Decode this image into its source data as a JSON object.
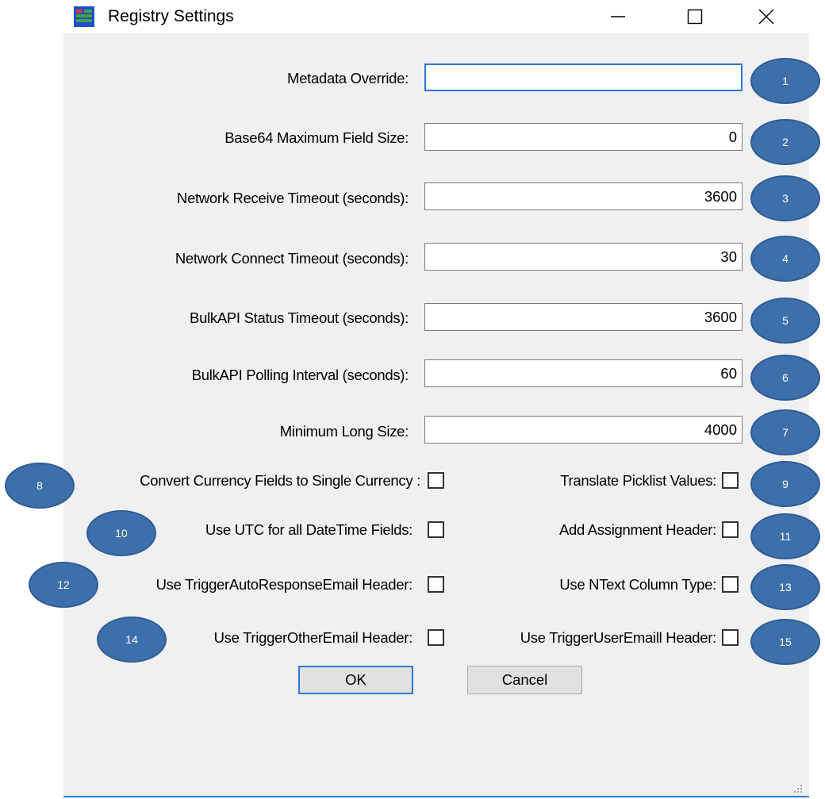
{
  "window": {
    "title": "Registry Settings"
  },
  "fields": [
    {
      "label": "Metadata Override:",
      "value": ""
    },
    {
      "label": "Base64 Maximum Field Size:",
      "value": "0"
    },
    {
      "label": "Network Receive Timeout (seconds):",
      "value": "3600"
    },
    {
      "label": "Network Connect Timeout (seconds):",
      "value": "30"
    },
    {
      "label": "BulkAPI Status Timeout (seconds):",
      "value": "3600"
    },
    {
      "label": "BulkAPI Polling Interval (seconds):",
      "value": "60"
    },
    {
      "label": "Minimum Long Size:",
      "value": "4000"
    }
  ],
  "checkboxes": {
    "left": [
      {
        "label": "Convert Currency Fields to Single Currency :",
        "checked": false
      },
      {
        "label": "Use UTC for all DateTime Fields:",
        "checked": false
      },
      {
        "label": "Use TriggerAutoResponseEmail Header:",
        "checked": false
      },
      {
        "label": "Use TriggerOtherEmail Header:",
        "checked": false
      }
    ],
    "right": [
      {
        "label": "Translate Picklist Values:",
        "checked": false
      },
      {
        "label": "Add Assignment Header:",
        "checked": false
      },
      {
        "label": "Use NText Column Type:",
        "checked": false
      },
      {
        "label": "Use TriggerUserEmaill Header:",
        "checked": false
      }
    ]
  },
  "badges": [
    "1",
    "2",
    "3",
    "4",
    "5",
    "6",
    "7",
    "8",
    "9",
    "10",
    "11",
    "12",
    "13",
    "14",
    "15"
  ],
  "buttons": {
    "ok": "OK",
    "cancel": "Cancel"
  },
  "colors": {
    "badge": "#3d6fab",
    "accent": "#2b79d8",
    "dialog_bg": "#f0f0f0"
  }
}
